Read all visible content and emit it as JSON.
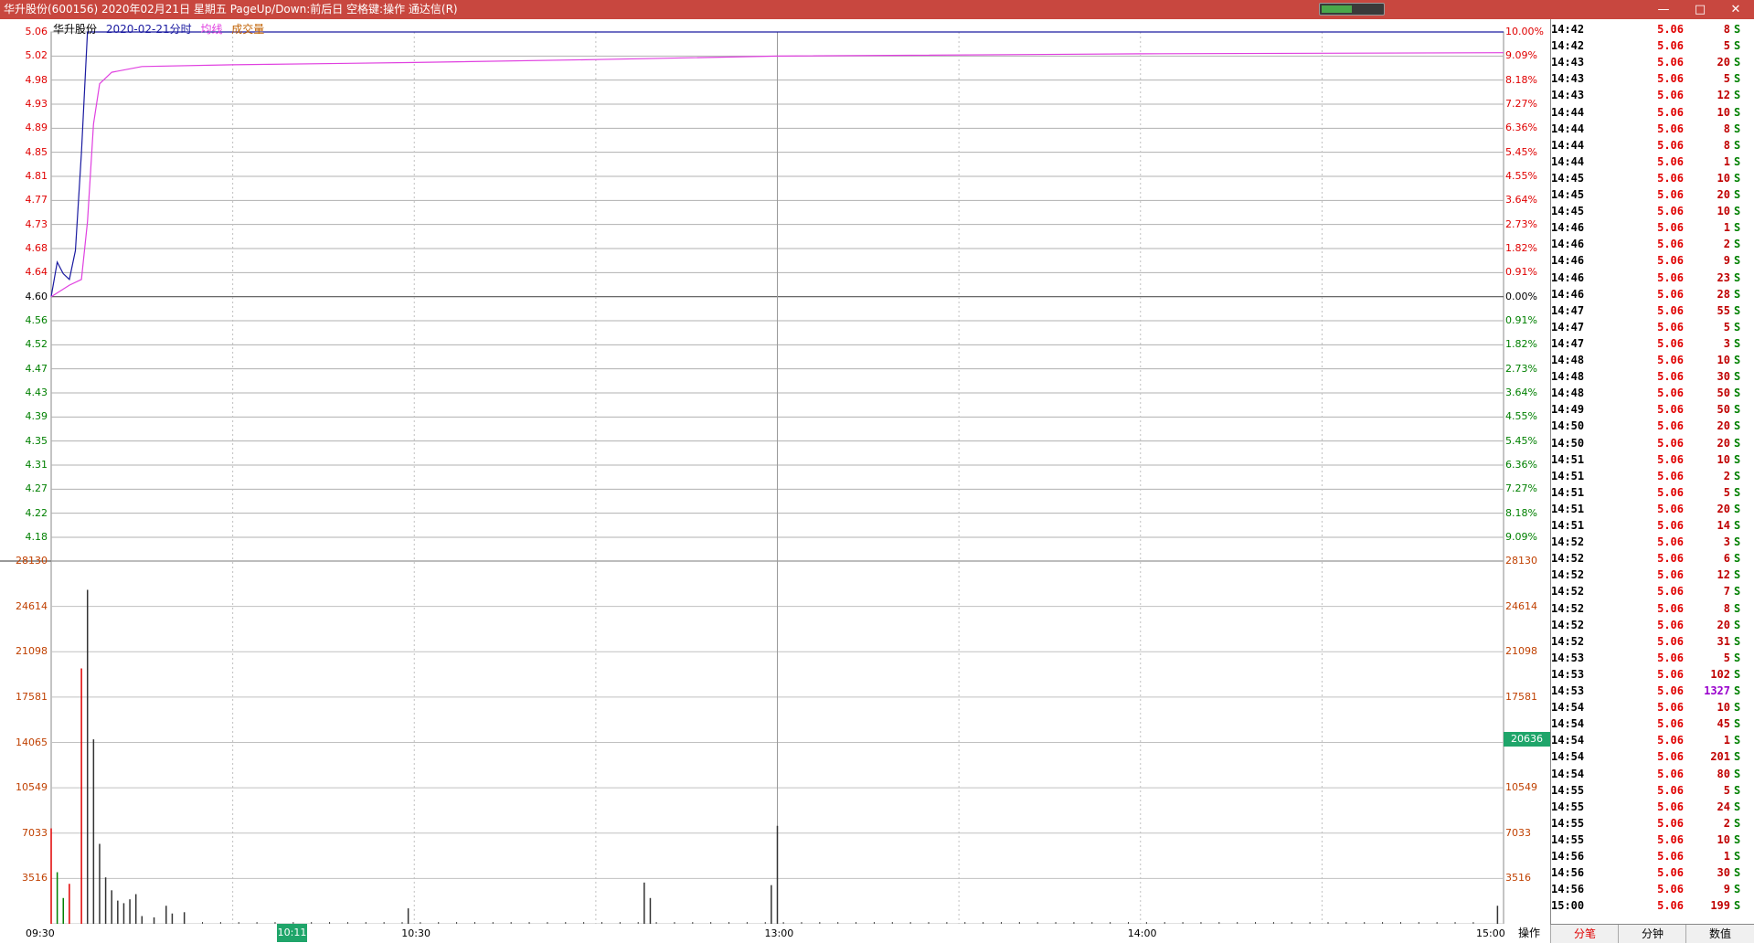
{
  "window": {
    "title": "华升股份(600156) 2020年02月21日 星期五 PageUp/Down:前后日 空格键:操作 通达信(R)",
    "progress_fraction": 0.5,
    "buttons": [
      "—",
      "□",
      "✕"
    ]
  },
  "legend": {
    "name": "华升股份",
    "date": "2020-02-21",
    "mode": "分时",
    "avg": "均线",
    "volume": "成交量"
  },
  "colors": {
    "titlebar": "#c8473f",
    "price_line": "#1a1aa0",
    "avg_line": "#e040e0",
    "up": "#e00000",
    "down": "#008000",
    "grid": "#a0a0a0",
    "accent_green": "#1fa56a"
  },
  "price_axis": {
    "left": [
      "5.06",
      "5.02",
      "4.98",
      "4.93",
      "4.89",
      "4.85",
      "4.81",
      "4.77",
      "4.73",
      "4.68",
      "4.64",
      "4.60",
      "4.56",
      "4.52",
      "4.47",
      "4.43",
      "4.39",
      "4.35",
      "4.31",
      "4.27",
      "4.22",
      "4.18"
    ],
    "right": [
      "10.00%",
      "9.09%",
      "8.18%",
      "7.27%",
      "6.36%",
      "5.45%",
      "4.55%",
      "3.64%",
      "2.73%",
      "1.82%",
      "0.91%",
      "0.00%",
      "0.91%",
      "1.82%",
      "2.73%",
      "3.64%",
      "4.55%",
      "5.45%",
      "6.36%",
      "7.27%",
      "8.18%",
      "9.09%"
    ]
  },
  "volume_axis": {
    "labels": [
      "28130",
      "24614",
      "21098",
      "17581",
      "14065",
      "10549",
      "7033",
      "3516"
    ],
    "current": "20636"
  },
  "time_axis": {
    "labels": [
      "09:30",
      "10:30",
      "13:00",
      "14:00",
      "15:00"
    ],
    "highlight": "10:11"
  },
  "ops_label": "操作",
  "chart_data": {
    "type": "line",
    "x_range": [
      "09:30",
      "15:00"
    ],
    "ylim": [
      4.14,
      5.06
    ],
    "prev_close": 4.6,
    "series": [
      {
        "name": "分时",
        "x": [
          "09:30",
          "09:31",
          "09:32",
          "09:33",
          "09:34",
          "09:35",
          "09:36",
          "09:37",
          "09:38",
          "15:00"
        ],
        "values": [
          4.6,
          4.66,
          4.64,
          4.63,
          4.68,
          4.85,
          5.06,
          5.06,
          5.06,
          5.06
        ]
      },
      {
        "name": "均线",
        "x": [
          "09:30",
          "09:33",
          "09:35",
          "09:36",
          "09:37",
          "09:38",
          "09:40",
          "09:45",
          "10:00",
          "10:30",
          "11:00",
          "13:00",
          "14:00",
          "15:00"
        ],
        "values": [
          4.6,
          4.62,
          4.63,
          4.73,
          4.9,
          4.97,
          4.99,
          5.0,
          5.003,
          5.007,
          5.012,
          5.018,
          5.022,
          5.024
        ]
      }
    ],
    "volume": {
      "ylim": [
        0,
        28130
      ],
      "bars": [
        {
          "t": "09:30",
          "v": 7400,
          "c": "up"
        },
        {
          "t": "09:31",
          "v": 4000,
          "c": "down"
        },
        {
          "t": "09:32",
          "v": 2000,
          "c": "down"
        },
        {
          "t": "09:33",
          "v": 3100,
          "c": "up"
        },
        {
          "t": "09:35",
          "v": 19800,
          "c": "up"
        },
        {
          "t": "09:36",
          "v": 25900,
          "c": "flat"
        },
        {
          "t": "09:37",
          "v": 14300,
          "c": "flat"
        },
        {
          "t": "09:38",
          "v": 6200,
          "c": "flat"
        },
        {
          "t": "09:39",
          "v": 3600,
          "c": "flat"
        },
        {
          "t": "09:40",
          "v": 2600,
          "c": "flat"
        },
        {
          "t": "09:41",
          "v": 1800,
          "c": "flat"
        },
        {
          "t": "09:42",
          "v": 1600,
          "c": "flat"
        },
        {
          "t": "09:43",
          "v": 1900,
          "c": "flat"
        },
        {
          "t": "09:44",
          "v": 2300,
          "c": "flat"
        },
        {
          "t": "09:45",
          "v": 600,
          "c": "flat"
        },
        {
          "t": "09:47",
          "v": 500,
          "c": "flat"
        },
        {
          "t": "09:49",
          "v": 1400,
          "c": "flat"
        },
        {
          "t": "09:50",
          "v": 800,
          "c": "flat"
        },
        {
          "t": "09:52",
          "v": 900,
          "c": "flat"
        },
        {
          "t": "10:29",
          "v": 1200,
          "c": "flat"
        },
        {
          "t": "11:08",
          "v": 3200,
          "c": "flat"
        },
        {
          "t": "11:09",
          "v": 2000,
          "c": "flat"
        },
        {
          "t": "12:59",
          "v": 3000,
          "c": "flat"
        },
        {
          "t": "13:00",
          "v": 7600,
          "c": "flat"
        },
        {
          "t": "14:59",
          "v": 1400,
          "c": "flat"
        }
      ]
    }
  },
  "ticks": [
    {
      "t": "14:42",
      "p": "5.06",
      "v": "8",
      "s": "S"
    },
    {
      "t": "14:42",
      "p": "5.06",
      "v": "5",
      "s": "S"
    },
    {
      "t": "14:43",
      "p": "5.06",
      "v": "20",
      "s": "S"
    },
    {
      "t": "14:43",
      "p": "5.06",
      "v": "5",
      "s": "S"
    },
    {
      "t": "14:43",
      "p": "5.06",
      "v": "12",
      "s": "S"
    },
    {
      "t": "14:44",
      "p": "5.06",
      "v": "10",
      "s": "S"
    },
    {
      "t": "14:44",
      "p": "5.06",
      "v": "8",
      "s": "S"
    },
    {
      "t": "14:44",
      "p": "5.06",
      "v": "8",
      "s": "S"
    },
    {
      "t": "14:44",
      "p": "5.06",
      "v": "1",
      "s": "S"
    },
    {
      "t": "14:45",
      "p": "5.06",
      "v": "10",
      "s": "S"
    },
    {
      "t": "14:45",
      "p": "5.06",
      "v": "20",
      "s": "S"
    },
    {
      "t": "14:45",
      "p": "5.06",
      "v": "10",
      "s": "S"
    },
    {
      "t": "14:46",
      "p": "5.06",
      "v": "1",
      "s": "S"
    },
    {
      "t": "14:46",
      "p": "5.06",
      "v": "2",
      "s": "S"
    },
    {
      "t": "14:46",
      "p": "5.06",
      "v": "9",
      "s": "S"
    },
    {
      "t": "14:46",
      "p": "5.06",
      "v": "23",
      "s": "S"
    },
    {
      "t": "14:46",
      "p": "5.06",
      "v": "28",
      "s": "S"
    },
    {
      "t": "14:47",
      "p": "5.06",
      "v": "55",
      "s": "S"
    },
    {
      "t": "14:47",
      "p": "5.06",
      "v": "5",
      "s": "S"
    },
    {
      "t": "14:47",
      "p": "5.06",
      "v": "3",
      "s": "S"
    },
    {
      "t": "14:48",
      "p": "5.06",
      "v": "10",
      "s": "S"
    },
    {
      "t": "14:48",
      "p": "5.06",
      "v": "30",
      "s": "S"
    },
    {
      "t": "14:48",
      "p": "5.06",
      "v": "50",
      "s": "S"
    },
    {
      "t": "14:49",
      "p": "5.06",
      "v": "50",
      "s": "S"
    },
    {
      "t": "14:50",
      "p": "5.06",
      "v": "20",
      "s": "S"
    },
    {
      "t": "14:50",
      "p": "5.06",
      "v": "20",
      "s": "S"
    },
    {
      "t": "14:51",
      "p": "5.06",
      "v": "10",
      "s": "S"
    },
    {
      "t": "14:51",
      "p": "5.06",
      "v": "2",
      "s": "S"
    },
    {
      "t": "14:51",
      "p": "5.06",
      "v": "5",
      "s": "S"
    },
    {
      "t": "14:51",
      "p": "5.06",
      "v": "20",
      "s": "S"
    },
    {
      "t": "14:51",
      "p": "5.06",
      "v": "14",
      "s": "S"
    },
    {
      "t": "14:52",
      "p": "5.06",
      "v": "3",
      "s": "S"
    },
    {
      "t": "14:52",
      "p": "5.06",
      "v": "6",
      "s": "S"
    },
    {
      "t": "14:52",
      "p": "5.06",
      "v": "12",
      "s": "S"
    },
    {
      "t": "14:52",
      "p": "5.06",
      "v": "7",
      "s": "S"
    },
    {
      "t": "14:52",
      "p": "5.06",
      "v": "8",
      "s": "S"
    },
    {
      "t": "14:52",
      "p": "5.06",
      "v": "20",
      "s": "S"
    },
    {
      "t": "14:52",
      "p": "5.06",
      "v": "31",
      "s": "S"
    },
    {
      "t": "14:53",
      "p": "5.06",
      "v": "5",
      "s": "S"
    },
    {
      "t": "14:53",
      "p": "5.06",
      "v": "102",
      "s": "S"
    },
    {
      "t": "14:53",
      "p": "5.06",
      "v": "1327",
      "s": "S"
    },
    {
      "t": "14:54",
      "p": "5.06",
      "v": "10",
      "s": "S"
    },
    {
      "t": "14:54",
      "p": "5.06",
      "v": "45",
      "s": "S"
    },
    {
      "t": "14:54",
      "p": "5.06",
      "v": "1",
      "s": "S"
    },
    {
      "t": "14:54",
      "p": "5.06",
      "v": "201",
      "s": "S"
    },
    {
      "t": "14:54",
      "p": "5.06",
      "v": "80",
      "s": "S"
    },
    {
      "t": "14:55",
      "p": "5.06",
      "v": "5",
      "s": "S"
    },
    {
      "t": "14:55",
      "p": "5.06",
      "v": "24",
      "s": "S"
    },
    {
      "t": "14:55",
      "p": "5.06",
      "v": "2",
      "s": "S"
    },
    {
      "t": "14:55",
      "p": "5.06",
      "v": "10",
      "s": "S"
    },
    {
      "t": "14:56",
      "p": "5.06",
      "v": "1",
      "s": "S"
    },
    {
      "t": "14:56",
      "p": "5.06",
      "v": "30",
      "s": "S"
    },
    {
      "t": "14:56",
      "p": "5.06",
      "v": "9",
      "s": "S"
    },
    {
      "t": "15:00",
      "p": "5.06",
      "v": "199",
      "s": "S"
    }
  ],
  "tabs": [
    "分笔",
    "分钟",
    "数值"
  ],
  "active_tab": 0
}
